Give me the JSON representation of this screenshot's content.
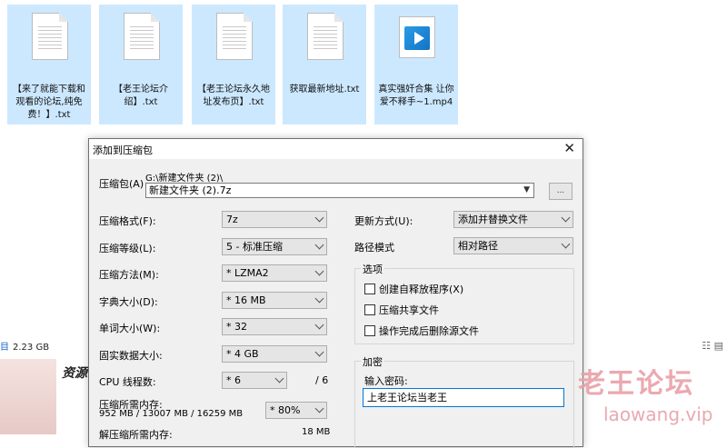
{
  "files": [
    {
      "name": "【来了就能下载和观看的论坛,纯免费！】.txt",
      "type": "text"
    },
    {
      "name": "【老王论坛介绍】.txt",
      "type": "text"
    },
    {
      "name": "【老王论坛永久地址发布页】.txt",
      "type": "text"
    },
    {
      "name": "获取最新地址.txt",
      "type": "text"
    },
    {
      "name": "真实强奸合集 让你爱不释手~1.mp4",
      "type": "video"
    }
  ],
  "explorer": {
    "size_text": "2.23 GB",
    "item_count_prefix": "目",
    "side_text": "资源"
  },
  "dialog": {
    "title": "添加到压缩包",
    "archive_label": "压缩包(A)",
    "archive_path": "G:\\新建文件夹 (2)\\",
    "archive_name": "新建文件夹 (2).7z",
    "browse_label": "...",
    "format_label": "压缩格式(F):",
    "format_value": "7z",
    "level_label": "压缩等级(L):",
    "level_value": "5 - 标准压缩",
    "method_label": "压缩方法(M):",
    "method_value": "* LZMA2",
    "dict_label": "字典大小(D):",
    "dict_value": "* 16 MB",
    "word_label": "单词大小(W):",
    "word_value": "* 32",
    "solid_label": "固实数据大小:",
    "solid_value": "* 4 GB",
    "threads_label": "CPU 线程数:",
    "threads_value": "* 6",
    "threads_max": "/ 6",
    "mem_label": "压缩所需内存:",
    "mem_value": "952 MB / 13007 MB / 16259 MB",
    "mem_percent": "* 80%",
    "decomp_label": "解压缩所需内存:",
    "decomp_value": "18 MB",
    "update_label": "更新方式(U):",
    "update_value": "添加并替换文件",
    "pathmode_label": "路径模式",
    "pathmode_value": "相对路径",
    "options_title": "选项",
    "opt_sfx": "创建自释放程序(X)",
    "opt_shared": "压缩共享文件",
    "opt_delete": "操作完成后删除源文件",
    "encrypt_title": "加密",
    "pwd_label": "输入密码:",
    "pwd_value": "上老王论坛当老王"
  },
  "watermark": {
    "line1": "老王论坛",
    "line2": "laowang.vip"
  }
}
